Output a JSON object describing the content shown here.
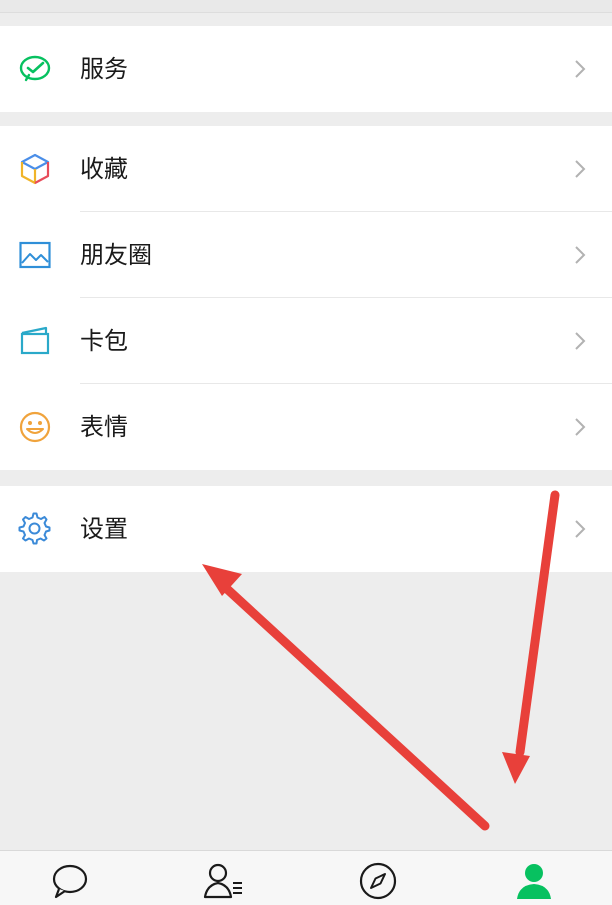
{
  "menu": {
    "services_label": "服务",
    "favorites_label": "收藏",
    "moments_label": "朋友圈",
    "cards_label": "卡包",
    "stickers_label": "表情",
    "settings_label": "设置"
  },
  "tabbar": {
    "tabs": [
      {
        "icon": "chat-bubble-icon"
      },
      {
        "icon": "contacts-icon"
      },
      {
        "icon": "compass-icon"
      },
      {
        "icon": "me-icon",
        "active": true
      }
    ]
  },
  "colors": {
    "active_green": "#07c160",
    "arrow_red": "#e8403a",
    "background": "#ededed"
  }
}
